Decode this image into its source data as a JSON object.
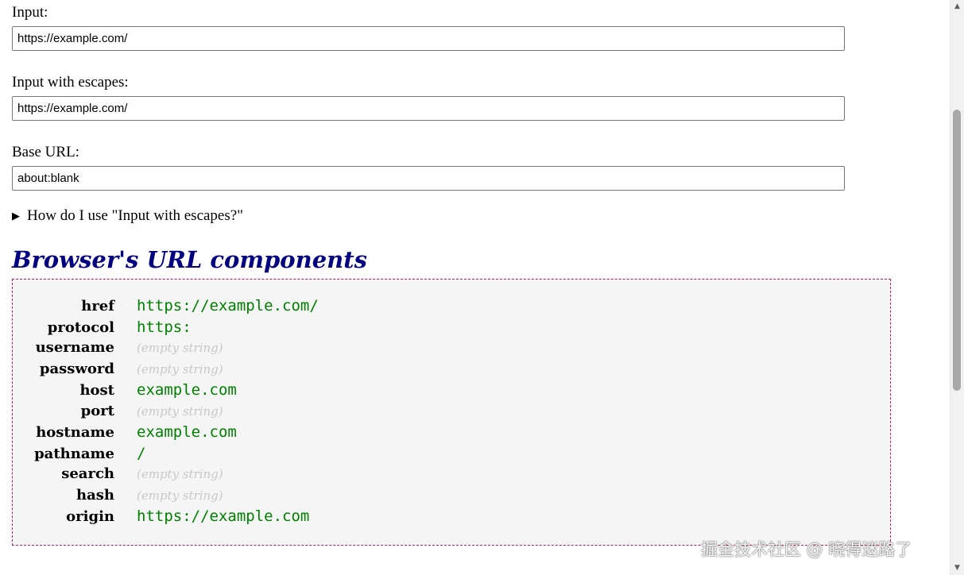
{
  "inputs": [
    {
      "label": "Input:",
      "value": "https://example.com/"
    },
    {
      "label": "Input with escapes:",
      "value": "https://example.com/"
    },
    {
      "label": "Base URL:",
      "value": "about:blank"
    }
  ],
  "details_summary": "How do I use \"Input with escapes?\"",
  "section_heading": "Browser's URL components",
  "components": [
    {
      "key": "href",
      "value": "https://example.com/"
    },
    {
      "key": "protocol",
      "value": "https:"
    },
    {
      "key": "username",
      "value": "(empty string)"
    },
    {
      "key": "password",
      "value": "(empty string)"
    },
    {
      "key": "host",
      "value": "example.com"
    },
    {
      "key": "port",
      "value": "(empty string)"
    },
    {
      "key": "hostname",
      "value": "example.com"
    },
    {
      "key": "pathname",
      "value": "/"
    },
    {
      "key": "search",
      "value": "(empty string)"
    },
    {
      "key": "hash",
      "value": "(empty string)"
    },
    {
      "key": "origin",
      "value": "https://example.com"
    }
  ],
  "watermark": "掘金技术社区 @ 晓得迷路了",
  "colors": {
    "heading": "#000080",
    "value": "#008000",
    "empty": "#c8c8c8",
    "box_border": "#c2185b"
  }
}
